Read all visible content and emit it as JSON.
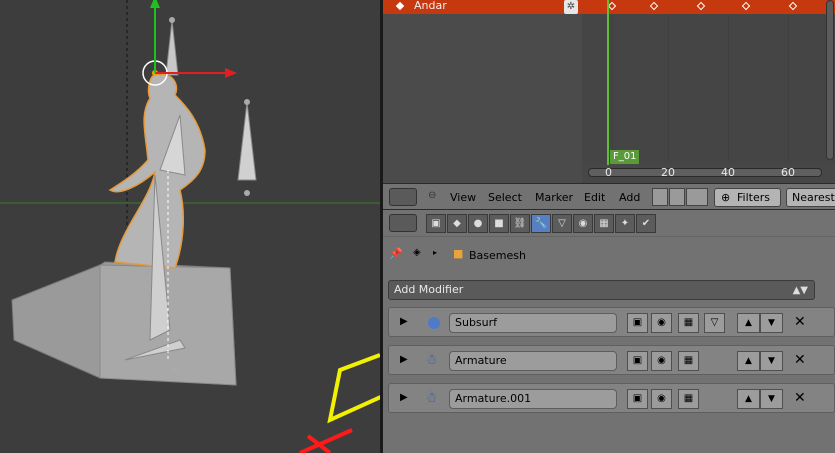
{
  "dopesheet": {
    "channel_label": "Andar",
    "frame_badge": "F_01",
    "ruler_numbers": [
      "0",
      "20",
      "40",
      "60"
    ],
    "header_items": [
      "View",
      "Select",
      "Marker",
      "Edit",
      "Add"
    ],
    "filters_label": "Filters",
    "interpolation_label": "Nearest"
  },
  "properties": {
    "breadcrumb_object": "Basemesh",
    "add_modifier_label": "Add Modifier",
    "modifiers": [
      {
        "name": "Subsurf",
        "icon": "subsurf-icon"
      },
      {
        "name": "Armature",
        "icon": "armature-icon"
      },
      {
        "name": "Armature.001",
        "icon": "armature-icon"
      }
    ]
  },
  "colors": {
    "channel_strip": "#c6390f",
    "active_tab": "#5680c2",
    "playhead": "#5fbf36",
    "annotation_yellow": "#f2f200",
    "annotation_red": "#ff1a1a"
  }
}
